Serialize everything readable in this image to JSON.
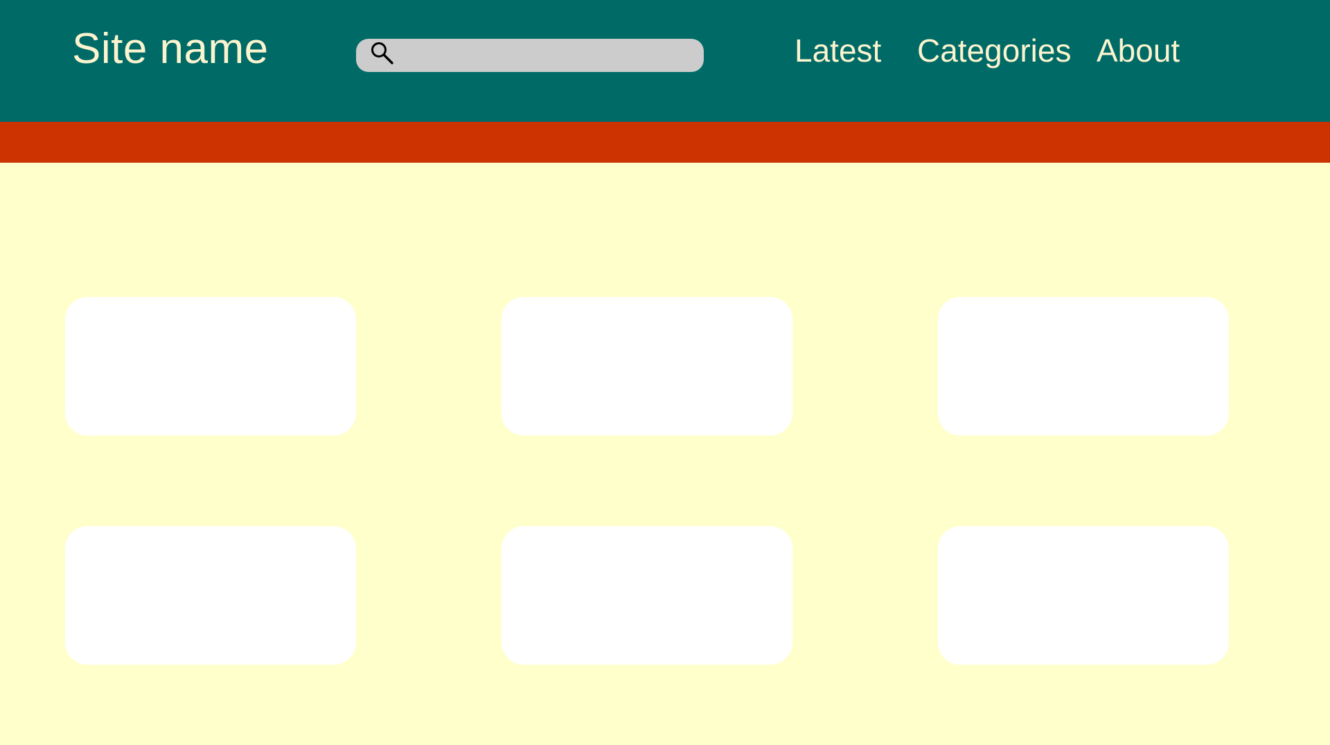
{
  "header": {
    "site_name": "Site name",
    "search": {
      "placeholder": "",
      "value": "",
      "icon": "magnifier-icon"
    },
    "nav": [
      {
        "label": "Latest"
      },
      {
        "label": "Categories"
      },
      {
        "label": "About"
      }
    ]
  },
  "colors": {
    "header_bg": "#006a67",
    "accent_bar": "#cc3300",
    "page_bg": "#ffffcc",
    "text_light": "#fcf4cf",
    "search_bg": "#cccccc",
    "card_bg": "#ffffff"
  },
  "main": {
    "cards": [
      {},
      {},
      {},
      {},
      {},
      {}
    ]
  }
}
